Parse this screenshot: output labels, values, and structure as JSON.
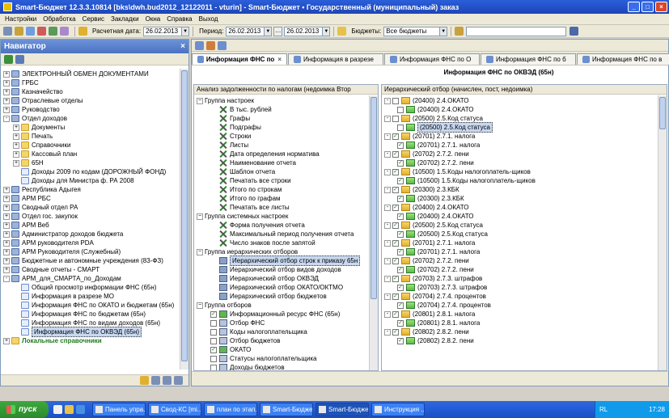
{
  "window": {
    "title": "Smart-Бюджет 12.3.3.10814 [bks\\dwh.bud2012_12122011 - vturin] - Smart-Бюджет • Государственный (муниципальный) заказ",
    "btn_min": "_",
    "btn_max": "□",
    "btn_close": "×"
  },
  "menu": [
    "Настройки",
    "Обработка",
    "Сервис",
    "Закладки",
    "Окна",
    "Справка",
    "Выход"
  ],
  "toolbar": {
    "calc_date_label": "Расчетная дата:",
    "calc_date": "26.02.2013",
    "period_label": "Период:",
    "period_from": "26.02.2013",
    "period_to": "26.02.2013",
    "budgets_label": "Бюджеты:",
    "budgets_value": "Все бюджеты",
    "ellipsis": "...",
    "dropdown_arrow": "▼"
  },
  "navigator": {
    "title": "Навигатор",
    "close": "×",
    "items": [
      {
        "exp": "+",
        "icon": "db",
        "label": "ЭЛЕКТРОННЫЙ ОБМЕН ДОКУМЕНТАМИ",
        "indent": 0
      },
      {
        "exp": "+",
        "icon": "db",
        "label": "ГРБС",
        "indent": 0
      },
      {
        "exp": "+",
        "icon": "db",
        "label": "Казначейство",
        "indent": 0
      },
      {
        "exp": "+",
        "icon": "db",
        "label": "Отраслевые отделы",
        "indent": 0
      },
      {
        "exp": "+",
        "icon": "db",
        "label": "Руководство",
        "indent": 0
      },
      {
        "exp": "-",
        "icon": "db",
        "label": "Отдел доходов",
        "indent": 0
      },
      {
        "exp": "+",
        "icon": "folder",
        "label": "Документы",
        "indent": 1
      },
      {
        "exp": "+",
        "icon": "folder",
        "label": "Печать",
        "indent": 1
      },
      {
        "exp": "+",
        "icon": "folder",
        "label": "Справочники",
        "indent": 1
      },
      {
        "exp": "+",
        "icon": "folder",
        "label": "Кассовый план",
        "indent": 1
      },
      {
        "exp": "+",
        "icon": "folder",
        "label": "65Н",
        "indent": 1
      },
      {
        "exp": "",
        "icon": "doc",
        "label": "Доходы 2009 по кодам (ДОРОЖНЫЙ ФОНД)",
        "indent": 1
      },
      {
        "exp": "",
        "icon": "doc",
        "label": "Доходы для Министра ф. РА 2008",
        "indent": 1
      },
      {
        "exp": "+",
        "icon": "db",
        "label": "Республика Адыгея",
        "indent": 0
      },
      {
        "exp": "+",
        "icon": "db",
        "label": "АРМ РБС",
        "indent": 0
      },
      {
        "exp": "+",
        "icon": "db",
        "label": "Сводный отдел РА",
        "indent": 0
      },
      {
        "exp": "+",
        "icon": "db",
        "label": "Отдел гос. закупок",
        "indent": 0
      },
      {
        "exp": "+",
        "icon": "db",
        "label": "АРМ Веб",
        "indent": 0
      },
      {
        "exp": "+",
        "icon": "db",
        "label": "Администратор доходов бюджета",
        "indent": 0
      },
      {
        "exp": "+",
        "icon": "db",
        "label": "АРМ руководителя PDA",
        "indent": 0
      },
      {
        "exp": "+",
        "icon": "db",
        "label": "АРМ Руководителя (Служебный)",
        "indent": 0
      },
      {
        "exp": "+",
        "icon": "db",
        "label": "Бюджетные и автономные учреждения (83-ФЗ)",
        "indent": 0
      },
      {
        "exp": "+",
        "icon": "db",
        "label": "Сводные отчеты - СМАРТ",
        "indent": 0
      },
      {
        "exp": "-",
        "icon": "db",
        "label": "АРМ_для_СМАРТА_по_Доходам",
        "indent": 0
      },
      {
        "exp": "",
        "icon": "doc",
        "label": "Общий просмотр информации ФНС (65н)",
        "indent": 1
      },
      {
        "exp": "",
        "icon": "doc",
        "label": "Информация в разрезе МО",
        "indent": 1
      },
      {
        "exp": "",
        "icon": "doc",
        "label": "Информация ФНС по ОКАТО и бюджетам (65н)",
        "indent": 1
      },
      {
        "exp": "",
        "icon": "doc",
        "label": "Информация ФНС по бюджетам (65н)",
        "indent": 1
      },
      {
        "exp": "",
        "icon": "doc",
        "label": "Информация ФНС по видам доходов (65н)",
        "indent": 1
      },
      {
        "exp": "",
        "icon": "doc",
        "label": "Информация ФНС по ОКВЭД (65н)",
        "indent": 1,
        "selected": true
      },
      {
        "exp": "+",
        "icon": "folder",
        "label": "Локальные справочники",
        "indent": 0,
        "green": true
      }
    ]
  },
  "tabs": [
    {
      "label": "Информация ФНС по",
      "active": true
    },
    {
      "label": "Информация в разрезе",
      "active": false
    },
    {
      "label": "Информация ФНС по О",
      "active": false
    },
    {
      "label": "Информация ФНС по б",
      "active": false
    },
    {
      "label": "Информация ФНС по в",
      "active": false
    }
  ],
  "tab_close": "×",
  "report_title": "Информация ФНС по ОКВЭД (65н)",
  "left_panel": {
    "header": "Анализ задолженности по налогам (недоимка Втор",
    "rows": [
      {
        "type": "group",
        "label": "Группа настроек"
      },
      {
        "type": "item",
        "icon": "wrench",
        "label": "В тыс. рублей"
      },
      {
        "type": "item",
        "icon": "wrench",
        "label": "Графы"
      },
      {
        "type": "item",
        "icon": "wrench",
        "label": "Подграфы"
      },
      {
        "type": "item",
        "icon": "wrench",
        "label": "Строки"
      },
      {
        "type": "item",
        "icon": "wrench",
        "label": "Листы"
      },
      {
        "type": "item",
        "icon": "wrench",
        "label": "Дата определения норматива"
      },
      {
        "type": "item",
        "icon": "wrench",
        "label": "Наименование отчета"
      },
      {
        "type": "item",
        "icon": "wrench",
        "label": "Шаблон отчета"
      },
      {
        "type": "item",
        "icon": "wrench",
        "label": "Печатать все строки"
      },
      {
        "type": "item",
        "icon": "wrench",
        "label": "Итого по строкам"
      },
      {
        "type": "item",
        "icon": "wrench",
        "label": "Итого по графам"
      },
      {
        "type": "item",
        "icon": "wrench",
        "label": "Печатать все листы"
      },
      {
        "type": "group",
        "label": "Группа системных настроек"
      },
      {
        "type": "item",
        "icon": "wrench",
        "label": "Форма получения отчета"
      },
      {
        "type": "item",
        "icon": "wrench",
        "label": "Максимальный период получения отчета"
      },
      {
        "type": "item",
        "icon": "wrench",
        "label": "Число знаков после запятой"
      },
      {
        "type": "group",
        "label": "Группа иерархических отборов"
      },
      {
        "type": "item",
        "icon": "bld",
        "label": "Иерархический отбор строк к приказу 65н",
        "selected": true
      },
      {
        "type": "item",
        "icon": "bld",
        "label": "Иерархический отбор видов доходов"
      },
      {
        "type": "item",
        "icon": "bld",
        "label": "Иерархический отбор ОКВЭД"
      },
      {
        "type": "item",
        "icon": "bld",
        "label": "Иерархический отбор ОКАТО/ОКТМО"
      },
      {
        "type": "item",
        "icon": "bld",
        "label": "Иерархический отбор бюджетов"
      },
      {
        "type": "group",
        "label": "Группа отборов"
      },
      {
        "type": "check",
        "checked": true,
        "label": "Информационный ресурс ФНС (65н)"
      },
      {
        "type": "check",
        "checked": false,
        "label": "Отбор ФНС"
      },
      {
        "type": "check",
        "checked": false,
        "label": "Коды налогоплательщика"
      },
      {
        "type": "check",
        "checked": false,
        "label": "Отбор бюджетов"
      },
      {
        "type": "check",
        "checked": true,
        "label": "ОКАТО"
      },
      {
        "type": "check",
        "checked": false,
        "label": "Статусы налогоплательщика"
      },
      {
        "type": "check",
        "checked": false,
        "label": "Доходы бюджетов"
      }
    ]
  },
  "right_panel": {
    "header": "Иерархический отбор (начислен, пост, недоимка)",
    "rows": [
      {
        "level": 0,
        "exp": "-",
        "checked": false,
        "icon": "y",
        "label": "(20400) 2.4.ОКАТО"
      },
      {
        "level": 1,
        "exp": "",
        "checked": false,
        "icon": "g",
        "label": "(20400) 2.4.ОКАТО"
      },
      {
        "level": 0,
        "exp": "-",
        "checked": false,
        "icon": "y",
        "label": "(20500) 2.5.Код статуса"
      },
      {
        "level": 1,
        "exp": "",
        "checked": false,
        "icon": "g",
        "label": "(20500) 2.5.Код статуса",
        "selected": true
      },
      {
        "level": 0,
        "exp": "-",
        "checked": true,
        "icon": "y",
        "label": "(20701) 2.7.1. налога"
      },
      {
        "level": 1,
        "exp": "",
        "checked": true,
        "icon": "g",
        "label": "(20701) 2.7.1. налога"
      },
      {
        "level": 0,
        "exp": "-",
        "checked": true,
        "icon": "y",
        "label": "(20702) 2.7.2. пени"
      },
      {
        "level": 1,
        "exp": "",
        "checked": true,
        "icon": "g",
        "label": "(20702) 2.7.2. пени"
      },
      {
        "level": 0,
        "exp": "-",
        "checked": true,
        "icon": "y",
        "label": "(10500) 1.5.Коды налогоплатель-щиков"
      },
      {
        "level": 1,
        "exp": "",
        "checked": true,
        "icon": "g",
        "label": "(10500) 1.5.Коды налогоплатель-щиков"
      },
      {
        "level": 0,
        "exp": "-",
        "checked": true,
        "icon": "y",
        "label": "(20300) 2.3.КБК"
      },
      {
        "level": 1,
        "exp": "",
        "checked": true,
        "icon": "g",
        "label": "(20300) 2.3.КБК"
      },
      {
        "level": 0,
        "exp": "-",
        "checked": true,
        "icon": "y",
        "label": "(20400) 2.4.ОКАТО"
      },
      {
        "level": 1,
        "exp": "",
        "checked": true,
        "icon": "g",
        "label": "(20400) 2.4.ОКАТО"
      },
      {
        "level": 0,
        "exp": "-",
        "checked": true,
        "icon": "y",
        "label": "(20500) 2.5.Код статуса"
      },
      {
        "level": 1,
        "exp": "",
        "checked": true,
        "icon": "g",
        "label": "(20500) 2.5.Код статуса"
      },
      {
        "level": 0,
        "exp": "-",
        "checked": true,
        "icon": "y",
        "label": "(20701) 2.7.1. налога"
      },
      {
        "level": 1,
        "exp": "",
        "checked": true,
        "icon": "g",
        "label": "(20701) 2.7.1. налога"
      },
      {
        "level": 0,
        "exp": "-",
        "checked": true,
        "icon": "y",
        "label": "(20702) 2.7.2. пени"
      },
      {
        "level": 1,
        "exp": "",
        "checked": true,
        "icon": "g",
        "label": "(20702) 2.7.2. пени"
      },
      {
        "level": 0,
        "exp": "-",
        "checked": true,
        "icon": "y",
        "label": "(20703) 2.7.3. штрафов"
      },
      {
        "level": 1,
        "exp": "",
        "checked": true,
        "icon": "g",
        "label": "(20703) 2.7.3. штрафов"
      },
      {
        "level": 0,
        "exp": "-",
        "checked": true,
        "icon": "y",
        "label": "(20704) 2.7.4. процентов"
      },
      {
        "level": 1,
        "exp": "",
        "checked": true,
        "icon": "g",
        "label": "(20704) 2.7.4. процентов"
      },
      {
        "level": 0,
        "exp": "-",
        "checked": true,
        "icon": "y",
        "label": "(20801) 2.8.1. налога"
      },
      {
        "level": 1,
        "exp": "",
        "checked": true,
        "icon": "g",
        "label": "(20801) 2.8.1. налога"
      },
      {
        "level": 0,
        "exp": "-",
        "checked": true,
        "icon": "y",
        "label": "(20802) 2.8.2. пени"
      },
      {
        "level": 1,
        "exp": "",
        "checked": true,
        "icon": "g",
        "label": "(20802) 2.8.2. пени"
      }
    ]
  },
  "taskbar": {
    "start": "пуск",
    "buttons": [
      {
        "label": "Панель упра...",
        "active": false
      },
      {
        "label": "Свод-КС [mi...",
        "active": false
      },
      {
        "label": "план по этап...",
        "active": false
      },
      {
        "label": "Smart-Бюдже...",
        "active": false
      },
      {
        "label": "Smart-Бюдже...",
        "active": true
      },
      {
        "label": "Инструкция ...",
        "active": false
      }
    ],
    "lang": "RL",
    "clock": "17:28"
  }
}
